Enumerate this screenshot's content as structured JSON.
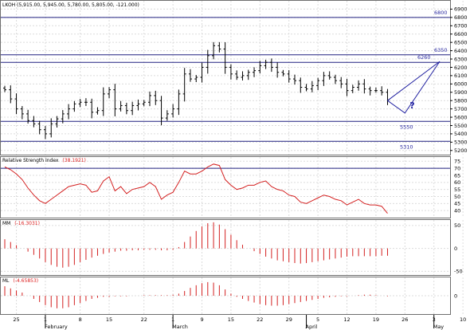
{
  "colors": {
    "price": "#000000",
    "rsi": "#d42020",
    "histogram": "#d42020",
    "levels": "#202080",
    "annotation": "#2020a0"
  },
  "chart_data": [
    {
      "type": "ohlc",
      "panel": "price",
      "title_prefix": "LKOH",
      "title_values": "(5,915.00, 5,945.00, 5,780.00, 5,805.00, -121.000)",
      "ylim": [
        5150,
        7000
      ],
      "yticks": [
        5200,
        5300,
        5400,
        5500,
        5600,
        5700,
        5800,
        5900,
        6000,
        6100,
        6200,
        6300,
        6400,
        6500,
        6600,
        6700,
        6800,
        6900
      ],
      "levels": [
        {
          "value": 6800,
          "label": "6800"
        },
        {
          "value": 6350,
          "label": "6350"
        },
        {
          "value": 6260,
          "label": "6260"
        },
        {
          "value": 5550,
          "label": "5550"
        },
        {
          "value": 5310,
          "label": "5310"
        }
      ],
      "forecast": {
        "start": [
          66,
          5800
        ],
        "low": [
          69,
          5650
        ],
        "high": [
          75,
          6270
        ],
        "label": "?"
      },
      "closes": [
        5930,
        5820,
        5700,
        5640,
        5560,
        5520,
        5450,
        5400,
        5520,
        5580,
        5640,
        5700,
        5760,
        5780,
        5780,
        5660,
        5680,
        5880,
        5930,
        5700,
        5740,
        5680,
        5740,
        5760,
        5780,
        5860,
        5800,
        5590,
        5640,
        5700,
        5880,
        6120,
        6060,
        6080,
        6200,
        6340,
        6460,
        6420,
        6200,
        6120,
        6080,
        6100,
        6140,
        6160,
        6220,
        6260,
        6200,
        6140,
        6120,
        6060,
        6040,
        5960,
        5940,
        5980,
        6040,
        6100,
        6080,
        6040,
        6000,
        5920,
        5960,
        6000,
        5940,
        5920,
        5920,
        5900,
        5805
      ]
    },
    {
      "type": "line",
      "panel": "rsi",
      "title_prefix": "Relative Strength Index",
      "title_value": "(38.1921)",
      "ylim": [
        35,
        78
      ],
      "yticks": [
        40,
        45,
        50,
        55,
        60,
        65,
        70,
        75
      ],
      "level": 70,
      "values": [
        71,
        69,
        66,
        62,
        56,
        51,
        47,
        45,
        48,
        51,
        54,
        57,
        58,
        59,
        58,
        53,
        54,
        61,
        64,
        54,
        57,
        52,
        55,
        56,
        57,
        60,
        57,
        48,
        51,
        53,
        60,
        68,
        66,
        66,
        68,
        71,
        73,
        72,
        62,
        58,
        55,
        56,
        58,
        58,
        60,
        61,
        57,
        55,
        54,
        51,
        50,
        46,
        45,
        47,
        49,
        51,
        50,
        48,
        47,
        44,
        46,
        48,
        45,
        44,
        44,
        43,
        38
      ]
    },
    {
      "type": "histogram",
      "panel": "mm",
      "title_prefix": "MM",
      "title_value": "(-16.3031)",
      "ylim": [
        -58,
        62
      ],
      "yticks": [
        50,
        0,
        -50
      ],
      "values": [
        20,
        14,
        7,
        0,
        -7,
        -14,
        -22,
        -30,
        -36,
        -40,
        -42,
        -40,
        -36,
        -30,
        -25,
        -20,
        -16,
        -12,
        -9,
        -7,
        -5,
        -5,
        -4,
        -4,
        -3,
        -3,
        -3,
        -4,
        -4,
        -3,
        3,
        14,
        26,
        38,
        48,
        55,
        57,
        52,
        42,
        30,
        18,
        8,
        0,
        -6,
        -12,
        -18,
        -22,
        -26,
        -28,
        -30,
        -32,
        -33,
        -32,
        -30,
        -28,
        -26,
        -24,
        -22,
        -20,
        -18,
        -17,
        -17,
        -17,
        -17,
        -17,
        -16,
        -16
      ]
    },
    {
      "type": "histogram",
      "panel": "ml",
      "title_prefix": "ML",
      "title_value": "(-4.65853)",
      "ylim": [
        -35,
        35
      ],
      "yticks": [
        0
      ],
      "values": [
        18,
        14,
        10,
        6,
        0,
        -6,
        -12,
        -18,
        -22,
        -24,
        -24,
        -22,
        -18,
        -14,
        -10,
        -6,
        -4,
        -2,
        -2,
        -1,
        -1,
        -1,
        0,
        0,
        1,
        1,
        1,
        1,
        1,
        2,
        4,
        9,
        15,
        20,
        24,
        26,
        25,
        20,
        12,
        4,
        -2,
        -6,
        -10,
        -13,
        -16,
        -18,
        -19,
        -19,
        -18,
        -16,
        -14,
        -12,
        -10,
        -8,
        -6,
        -4,
        -3,
        -2,
        -1,
        -1,
        0,
        1,
        2,
        2,
        1,
        0,
        -1
      ]
    }
  ],
  "xaxis": {
    "ticks": [
      {
        "bar": 2,
        "label": "25"
      },
      {
        "bar": 7,
        "label": "1"
      },
      {
        "bar": 13,
        "label": "8"
      },
      {
        "bar": 18,
        "label": "15"
      },
      {
        "bar": 24,
        "label": "22"
      },
      {
        "bar": 29,
        "label": "1"
      },
      {
        "bar": 34,
        "label": "9"
      },
      {
        "bar": 39,
        "label": "15"
      },
      {
        "bar": 44,
        "label": "22"
      },
      {
        "bar": 49,
        "label": "29"
      },
      {
        "bar": 54,
        "label": "5"
      },
      {
        "bar": 59,
        "label": "12"
      },
      {
        "bar": 64,
        "label": "19"
      },
      {
        "bar": 69,
        "label": "26"
      },
      {
        "bar": 74,
        "label": "3"
      },
      {
        "bar": 79,
        "label": "10"
      },
      {
        "bar": 84,
        "label": "17"
      }
    ],
    "months": [
      {
        "bar": 7,
        "label": "February"
      },
      {
        "bar": 29,
        "label": "March"
      },
      {
        "bar": 52,
        "label": "April"
      },
      {
        "bar": 74,
        "label": "May"
      }
    ]
  }
}
